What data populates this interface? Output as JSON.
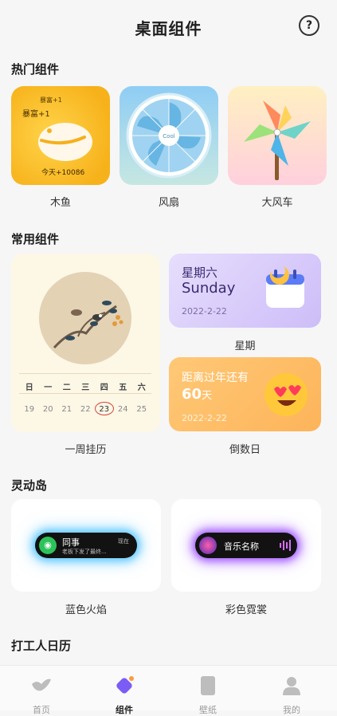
{
  "header": {
    "title": "桌面组件",
    "help_icon": "question-circle-icon"
  },
  "sections": {
    "hot": "热门组件",
    "common": "常用组件",
    "island": "灵动岛",
    "worker": "打工人日历"
  },
  "hot_widgets": {
    "muyu": {
      "name": "木鱼",
      "small1": "暴富+1",
      "small2": "暴富+1",
      "today": "今天+10086"
    },
    "fan": {
      "name": "风扇",
      "brand": "Cool"
    },
    "windmill": {
      "name": "大风车"
    }
  },
  "common_widgets": {
    "calendar": {
      "name": "一周挂历",
      "weekdays": [
        "日",
        "一",
        "二",
        "三",
        "四",
        "五",
        "六"
      ],
      "days": [
        "19",
        "20",
        "21",
        "22",
        "23",
        "24",
        "25"
      ],
      "highlight_index": 4
    },
    "week": {
      "name": "星期",
      "cn": "星期六",
      "en": "Sunday",
      "date": "2022-2-22"
    },
    "countdown": {
      "name": "倒数日",
      "title": "距离过年还有",
      "days_num": "60",
      "days_unit": "天",
      "date": "2022-2-22"
    }
  },
  "island_widgets": {
    "blue": {
      "name": "蓝色火焰",
      "title": "同事",
      "subtitle": "老板下发了最终...",
      "time": "现在"
    },
    "rainbow": {
      "name": "彩色霓裳",
      "title": "音乐名称"
    }
  },
  "tabs": [
    {
      "label": "首页",
      "icon": "bird-icon"
    },
    {
      "label": "组件",
      "icon": "widget-icon"
    },
    {
      "label": "壁纸",
      "icon": "wallpaper-icon"
    },
    {
      "label": "我的",
      "icon": "profile-icon"
    }
  ],
  "colors": {
    "accent": "#7b5cf5",
    "tab_inactive": "#9b9b9b"
  }
}
